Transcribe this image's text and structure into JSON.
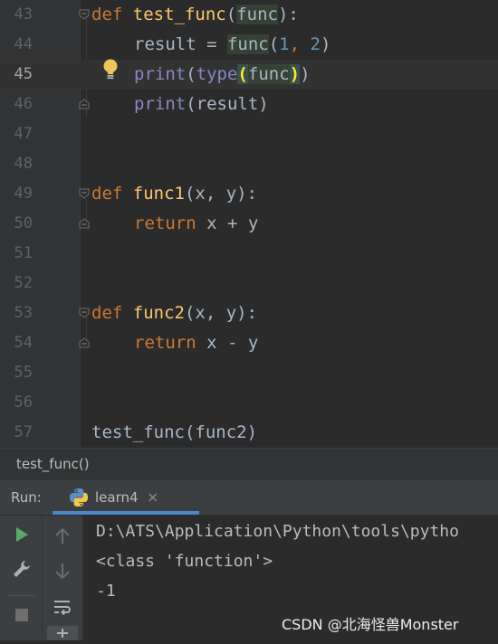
{
  "editor": {
    "line_numbers": [
      "43",
      "44",
      "45",
      "46",
      "47",
      "48",
      "49",
      "50",
      "51",
      "52",
      "53",
      "54",
      "55",
      "56",
      "57"
    ],
    "current_line": "45",
    "code": {
      "l43_kw": "def",
      "l43_fn": "test_func",
      "l43_open": "(",
      "l43_arg": "func",
      "l43_close": "):",
      "l44_a": "result = ",
      "l44_fn": "func",
      "l44_open": "(",
      "l44_n1": "1",
      "l44_comma": ", ",
      "l44_n2": "2",
      "l44_close": ")",
      "l45_print": "print",
      "l45_open": "(",
      "l45_type": "type",
      "l45_p2": "(",
      "l45_arg": "func",
      "l45_p3": ")",
      "l45_close": ")",
      "l46_print": "print",
      "l46_rest": "(result)",
      "l49_kw": "def",
      "l49_fn": "func1",
      "l49_rest": "(x, y):",
      "l50_kw": "return",
      "l50_rest": " x + y",
      "l53_kw": "def",
      "l53_fn": "func2",
      "l53_rest": "(x, y):",
      "l54_kw": "return",
      "l54_rest": " x - y",
      "l57": "test_func(func2)"
    }
  },
  "breadcrumb": "test_func()",
  "run_panel": {
    "label": "Run:",
    "tab_label": "learn4",
    "tab_close": "×",
    "console_lines": [
      "D:\\ATS\\Application\\Python\\tools\\pytho",
      "<class 'function'>",
      "-1"
    ]
  },
  "watermark": "CSDN @北海怪兽Monster",
  "colors": {
    "keyword": "#cc7832",
    "function": "#ffc66d",
    "number": "#6897bb",
    "builtin": "#8888c6",
    "accent": "#4a88c7"
  }
}
